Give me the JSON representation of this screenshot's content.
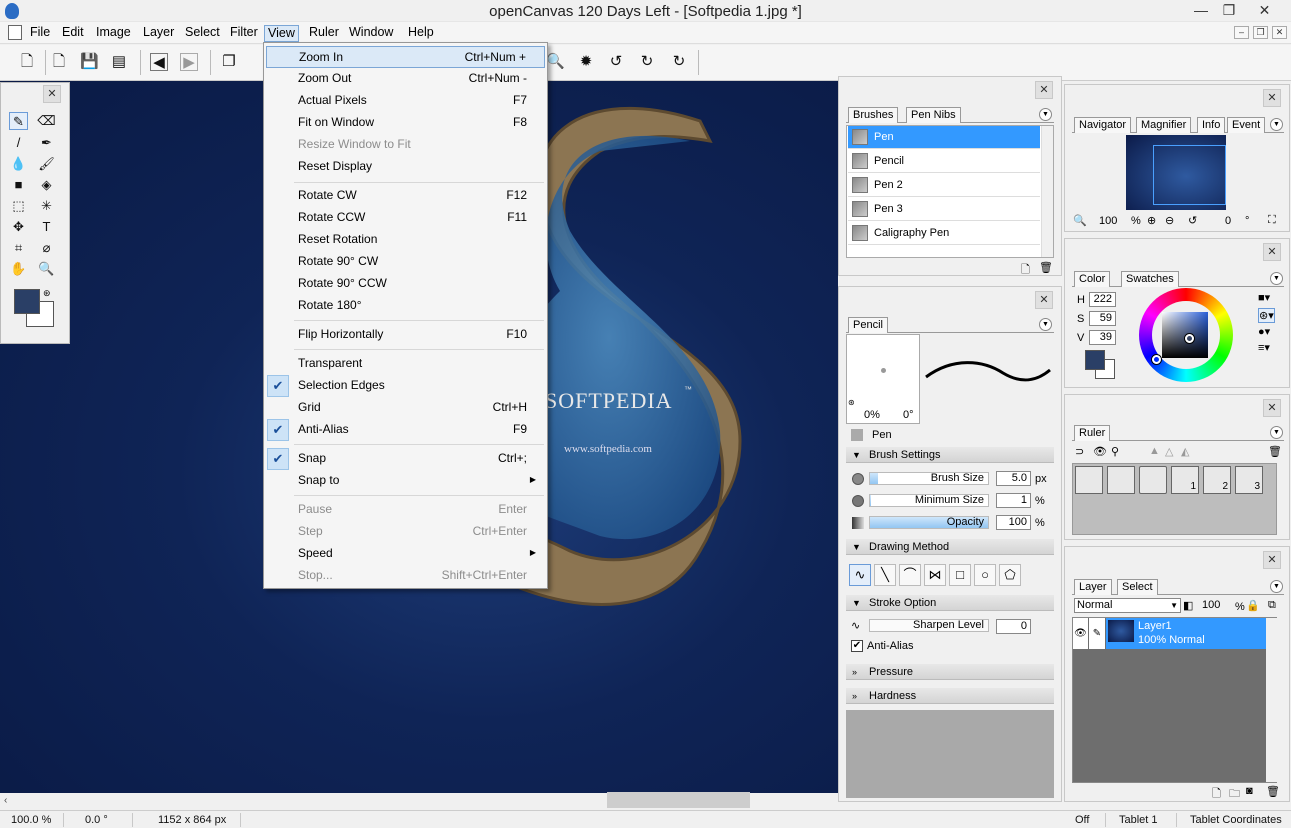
{
  "window": {
    "title": "openCanvas 120 Days Left - [Softpedia 1.jpg *]",
    "minimize": "—",
    "maximize": "❐",
    "close": "✕",
    "mdi_buttons": [
      "–",
      "❐",
      "✕"
    ]
  },
  "menubar": {
    "items": [
      "File",
      "Edit",
      "Image",
      "Layer",
      "Select",
      "Filter",
      "View",
      "Ruler",
      "Window",
      "Help"
    ],
    "active": "View"
  },
  "view_menu": {
    "items": [
      {
        "label": "Zoom In",
        "shortcut": "Ctrl+Num +"
      },
      {
        "label": "Zoom Out",
        "shortcut": "Ctrl+Num -"
      },
      {
        "label": "Actual Pixels",
        "shortcut": "F7"
      },
      {
        "label": "Fit on Window",
        "shortcut": "F8"
      },
      {
        "label": "Resize Window to Fit",
        "shortcut": ""
      },
      {
        "label": "Reset Display",
        "shortcut": ""
      },
      {
        "label": "Rotate CW",
        "shortcut": "F12"
      },
      {
        "label": "Rotate CCW",
        "shortcut": "F11"
      },
      {
        "label": "Reset Rotation",
        "shortcut": ""
      },
      {
        "label": "Rotate 90° CW",
        "shortcut": ""
      },
      {
        "label": "Rotate 90° CCW",
        "shortcut": ""
      },
      {
        "label": "Rotate 180°",
        "shortcut": ""
      },
      {
        "label": "Flip Horizontally",
        "shortcut": "F10"
      },
      {
        "label": "Transparent",
        "shortcut": ""
      },
      {
        "label": "Selection Edges",
        "shortcut": ""
      },
      {
        "label": "Grid",
        "shortcut": "Ctrl+H"
      },
      {
        "label": "Anti-Alias",
        "shortcut": "F9"
      },
      {
        "label": "Snap",
        "shortcut": "Ctrl+;"
      },
      {
        "label": "Snap to",
        "shortcut": ""
      },
      {
        "label": "Pause",
        "shortcut": "Enter"
      },
      {
        "label": "Step",
        "shortcut": "Ctrl+Enter"
      },
      {
        "label": "Speed",
        "shortcut": ""
      },
      {
        "label": "Stop...",
        "shortcut": "Shift+Ctrl+Enter"
      }
    ]
  },
  "canvas": {
    "watermark_title": "SOFTPEDIA",
    "watermark_tm": "™",
    "watermark_url": "www.softpedia.com"
  },
  "brushes_panel": {
    "tabs": [
      "Brushes",
      "Pen Nibs"
    ],
    "items": [
      "Pen",
      "Pencil",
      "Pen 2",
      "Pen 3",
      "Caligraphy Pen"
    ],
    "selected": "Pen"
  },
  "pencil_panel": {
    "tab": "Pencil",
    "preview_angle_pct": "0%",
    "preview_angle_deg": "0°",
    "current_brush": "Pen",
    "brush_settings": {
      "header": "Brush Settings",
      "brush_size_label": "Brush Size",
      "brush_size_value": "5.0",
      "brush_size_unit": "px",
      "min_size_label": "Minimum Size",
      "min_size_value": "1",
      "min_size_unit": "%",
      "opacity_label": "Opacity",
      "opacity_value": "100",
      "opacity_unit": "%",
      "brush_size_fill": 0.07,
      "min_size_fill": 0.01,
      "opacity_fill": 1.0
    },
    "drawing_method_header": "Drawing Method",
    "stroke_option_header": "Stroke Option",
    "sharpen_label": "Sharpen Level",
    "sharpen_value": "0",
    "anti_alias_label": "Anti-Alias",
    "pressure_header": "Pressure",
    "hardness_header": "Hardness"
  },
  "navigator_panel": {
    "tabs": [
      "Navigator",
      "Magnifier",
      "Info",
      "Event"
    ],
    "zoom_value": "100",
    "zoom_unit": "%",
    "rotation_value": "0",
    "rotation_unit": "°"
  },
  "color_panel": {
    "tabs": [
      "Color",
      "Swatches"
    ],
    "h_label": "H",
    "h_value": "222",
    "s_label": "S",
    "s_value": "59",
    "v_label": "V",
    "v_value": "39",
    "foreground": "#2a3f66"
  },
  "ruler_panel": {
    "tabs": [
      "Ruler"
    ],
    "presets": [
      "",
      "",
      "",
      "1",
      "2",
      "3"
    ]
  },
  "layer_panel": {
    "tabs": [
      "Layer",
      "Select"
    ],
    "blend_mode": "Normal",
    "opacity_value": "100",
    "opacity_unit": "%",
    "layers": [
      {
        "name": "Layer1",
        "info": "100% Normal"
      }
    ]
  },
  "statusbar": {
    "zoom": "100.0 %",
    "rotation": "0.0 °",
    "size": "1152 x 864 px",
    "tablet_state": "Off",
    "tablet_name": "Tablet 1",
    "tablet_coords": "Tablet Coordinates"
  },
  "colors": {
    "highlight": "#3399ff",
    "menu_hover": "#dbe9f7",
    "canvas_bg": "#0f2456",
    "foreground_swatch": "#2a3f66"
  }
}
